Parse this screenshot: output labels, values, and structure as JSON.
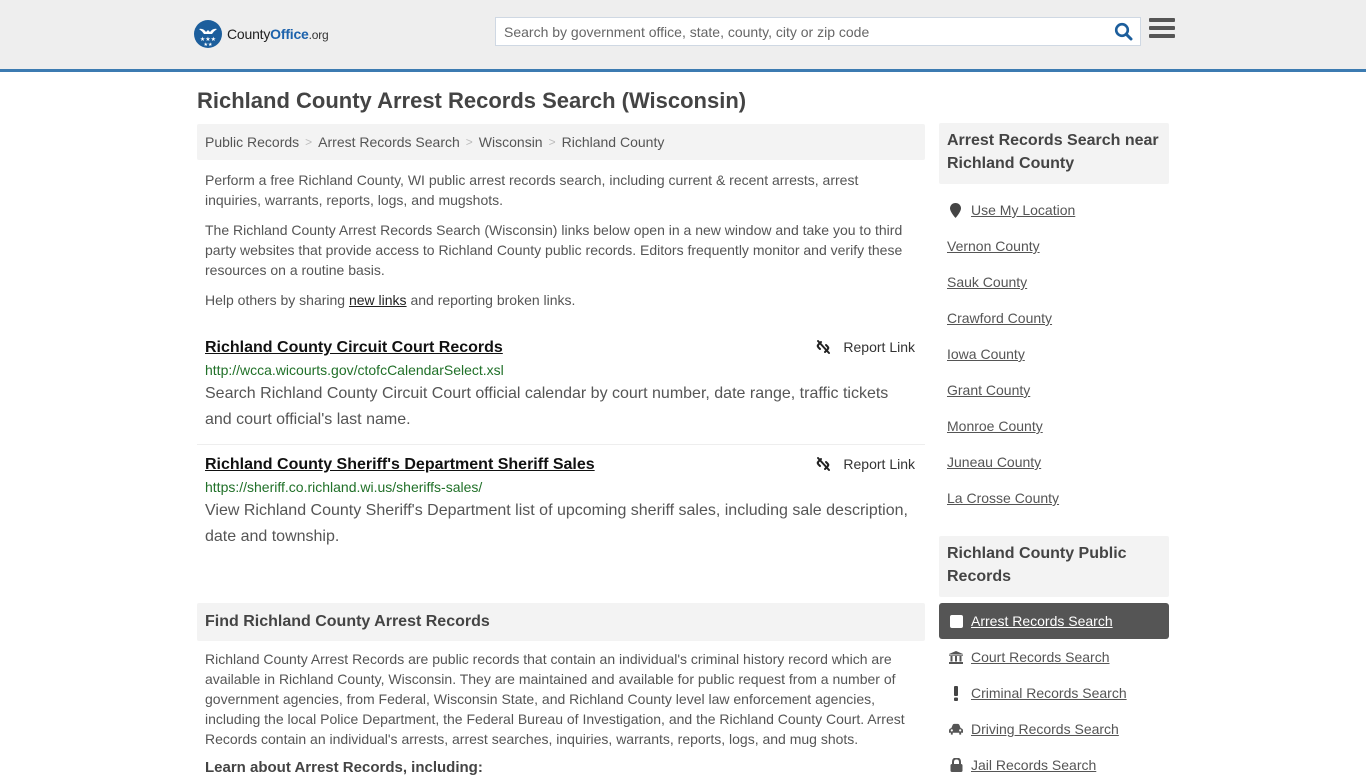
{
  "header": {
    "logo": {
      "part1": "County",
      "part2": "Office",
      "part3": ".org"
    },
    "search_placeholder": "Search by government office, state, county, city or zip code",
    "search_value": "",
    "accent_color": "#3c7bb1"
  },
  "page_title": "Richland County Arrest Records Search (Wisconsin)",
  "breadcrumb": [
    "Public Records",
    "Arrest Records Search",
    "Wisconsin",
    "Richland County"
  ],
  "intro": {
    "p1": "Perform a free Richland County, WI public arrest records search, including current & recent arrests, arrest inquiries, warrants, reports, logs, and mugshots.",
    "p2": "The Richland County Arrest Records Search (Wisconsin) links below open in a new window and take you to third party websites that provide access to Richland County public records. Editors frequently monitor and verify these resources on a routine basis.",
    "p3_before": "Help others by sharing ",
    "p3_link": "new links",
    "p3_after": " and reporting broken links."
  },
  "results": [
    {
      "title": "Richland County Circuit Court Records",
      "url": "http://wcca.wicourts.gov/ctofcCalendarSelect.xsl",
      "description": "Search Richland County Circuit Court official calendar by court number, date range, traffic tickets and court official's last name.",
      "report_label": "Report Link"
    },
    {
      "title": "Richland County Sheriff's Department Sheriff Sales",
      "url": "https://sheriff.co.richland.wi.us/sheriffs-sales/",
      "description": "View Richland County Sheriff's Department list of upcoming sheriff sales, including sale description, date and township.",
      "report_label": "Report Link"
    }
  ],
  "find_section": {
    "heading": "Find Richland County Arrest Records",
    "body": "Richland County Arrest Records are public records that contain an individual's criminal history record which are available in Richland County, Wisconsin. They are maintained and available for public request from a number of government agencies, from Federal, Wisconsin State, and Richland County level law enforcement agencies, including the local Police Department, the Federal Bureau of Investigation, and the Richland County Court. Arrest Records contain an individual's arrests, arrest searches, inquiries, warrants, reports, logs, and mug shots.",
    "learn_heading": "Learn about Arrest Records, including:"
  },
  "sidebar": {
    "near_heading": "Arrest Records Search near Richland County",
    "use_location": "Use My Location",
    "nearby": [
      "Vernon County",
      "Sauk County",
      "Crawford County",
      "Iowa County",
      "Grant County",
      "Monroe County",
      "Juneau County",
      "La Crosse County"
    ],
    "records_heading": "Richland County Public Records",
    "records": [
      {
        "label": "Arrest Records Search",
        "icon": "square-icon",
        "active": true
      },
      {
        "label": "Court Records Search",
        "icon": "courthouse-icon",
        "active": false
      },
      {
        "label": "Criminal Records Search",
        "icon": "exclamation-icon",
        "active": false
      },
      {
        "label": "Driving Records Search",
        "icon": "car-icon",
        "active": false
      },
      {
        "label": "Jail Records Search",
        "icon": "lock-icon",
        "active": false
      }
    ]
  }
}
